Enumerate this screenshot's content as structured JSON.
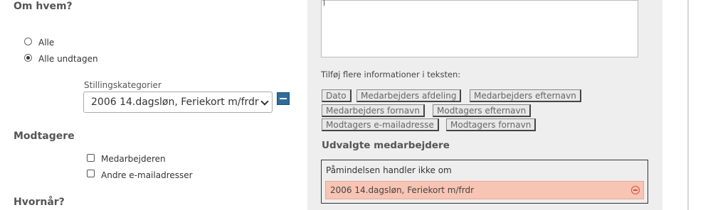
{
  "who": {
    "heading": "Om hvem?",
    "options": [
      "Alle",
      "Alle undtagen"
    ],
    "selected": "Alle undtagen",
    "category_label": "Stillingskategorier",
    "category_value": "2006 14.dagsløn, Feriekort m/frdr"
  },
  "recipients": {
    "heading": "Modtagere",
    "options": [
      "Medarbejderen",
      "Andre e-mailadresser"
    ]
  },
  "when": {
    "heading": "Hvornår?"
  },
  "insert": {
    "label": "Tilføj flere informationer i teksten:",
    "tokens": [
      "Dato",
      "Medarbejders afdeling",
      "Medarbejders efternavn",
      "Medarbejders fornavn",
      "Modtagers efternavn",
      "Modtagers e-mailadresse",
      "Modtagers fornavn"
    ]
  },
  "selected_employees": {
    "heading": "Udvalgte medarbejdere",
    "box_label": "Påmindelsen handler ikke om",
    "item": "2006 14.dagsløn, Feriekort m/frdr"
  },
  "colors": {
    "panel_bg": "#eeeeee",
    "accent_blue": "#2f6b9c",
    "chip_pink": "#f8c4b4",
    "remove_red": "#d2503c"
  }
}
